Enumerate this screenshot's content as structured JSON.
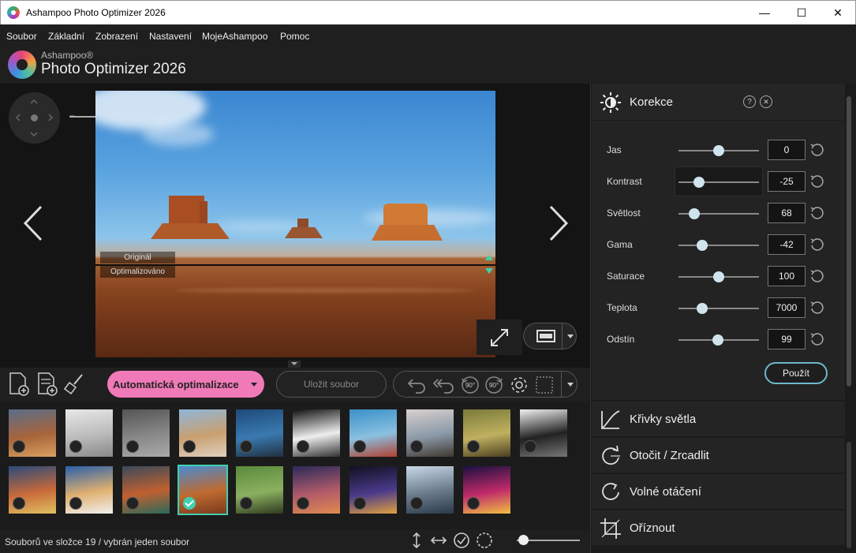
{
  "window": {
    "title": "Ashampoo Photo Optimizer 2026",
    "minimize": "—",
    "maximize": "☐",
    "close": "✕"
  },
  "menu": {
    "items": [
      "Soubor",
      "Základní",
      "Zobrazení",
      "Nastavení",
      "MojeAshampoo",
      "Pomoc"
    ]
  },
  "logo": {
    "brand": "Ashampoo®",
    "product": "Photo Optimizer 2026"
  },
  "viewer": {
    "zoom_minus": "−",
    "zoom_plus": "+",
    "zoom_level": 0.38,
    "label_original": "Originál",
    "label_optimized": "Optimalizováno"
  },
  "toolbar": {
    "auto_optimize": "Automatická optimalizace",
    "save_file": "Uložit soubor",
    "rotate_left_label": "90°",
    "rotate_right_label": "90°"
  },
  "thumbnails": {
    "count": 19,
    "selected_index": 13,
    "items": [
      {
        "colors": [
          "#5a6e8a",
          "#a8643a",
          "#d9a060"
        ]
      },
      {
        "colors": [
          "#e8e8e8",
          "#bbbbbb",
          "#888888"
        ]
      },
      {
        "colors": [
          "#555555",
          "#888888",
          "#aaaaaa"
        ]
      },
      {
        "colors": [
          "#8fb6d8",
          "#c9a070",
          "#e0d0c0"
        ]
      },
      {
        "colors": [
          "#1e4a7a",
          "#3a7ab0",
          "#203040"
        ]
      },
      {
        "colors": [
          "#111111",
          "#eeeeee",
          "#333333"
        ]
      },
      {
        "colors": [
          "#3a90c8",
          "#8ac0e0",
          "#b04030"
        ]
      },
      {
        "colors": [
          "#d8d0d0",
          "#8a9aa8",
          "#403830"
        ]
      },
      {
        "colors": [
          "#7a7a3a",
          "#c0b060",
          "#4a4020"
        ]
      },
      {
        "colors": [
          "#f0f0f0",
          "#222222",
          "#777777"
        ]
      },
      {
        "colors": [
          "#2a4a7a",
          "#c86a3a",
          "#e0c060"
        ]
      },
      {
        "colors": [
          "#2a60a8",
          "#e0b070",
          "#f0f0f0"
        ]
      },
      {
        "colors": [
          "#3a4a5a",
          "#c06030",
          "#2a6a5a"
        ]
      },
      {
        "colors": [
          "#4a8ad0",
          "#c06a30",
          "#7a3a1c"
        ]
      },
      {
        "colors": [
          "#5a8a3a",
          "#8ab060",
          "#303a20"
        ]
      },
      {
        "colors": [
          "#2a2a5a",
          "#b05a6a",
          "#e08a50"
        ]
      },
      {
        "colors": [
          "#101020",
          "#4a3a8a",
          "#e0a040"
        ]
      },
      {
        "colors": [
          "#c8d8e8",
          "#6a7a8a",
          "#2a3a4a"
        ]
      },
      {
        "colors": [
          "#1a1040",
          "#c02a6a",
          "#f0c040"
        ]
      }
    ]
  },
  "status": {
    "text": "Souborů ve složce 19 / vybrán jeden soubor",
    "thumb_size": 0.1
  },
  "panel": {
    "title": "Korekce",
    "help": "?",
    "close": "✕",
    "apply": "Použít",
    "sliders": [
      {
        "label": "Jas",
        "value": "0",
        "position": 0.5
      },
      {
        "label": "Kontrast",
        "value": "-25",
        "position": 0.25
      },
      {
        "label": "Světlost",
        "value": "68",
        "position": 0.2
      },
      {
        "label": "Gama",
        "value": "-42",
        "position": 0.29
      },
      {
        "label": "Saturace",
        "value": "100",
        "position": 0.5
      },
      {
        "label": "Teplota",
        "value": "7000",
        "position": 0.29
      },
      {
        "label": "Odstín",
        "value": "99",
        "position": 0.49
      }
    ],
    "tools": [
      {
        "label": "Křivky světla",
        "icon": "curves-icon"
      },
      {
        "label": "Otočit / Zrcadlit",
        "icon": "rotate-icon"
      },
      {
        "label": "Volné otáčení",
        "icon": "free-rotate-icon"
      },
      {
        "label": "Oříznout",
        "icon": "crop-icon"
      }
    ]
  },
  "colors": {
    "accent_pink": "#f07ab8",
    "accent_teal": "#3fd0b0",
    "apply_border": "#6fb8cc"
  }
}
